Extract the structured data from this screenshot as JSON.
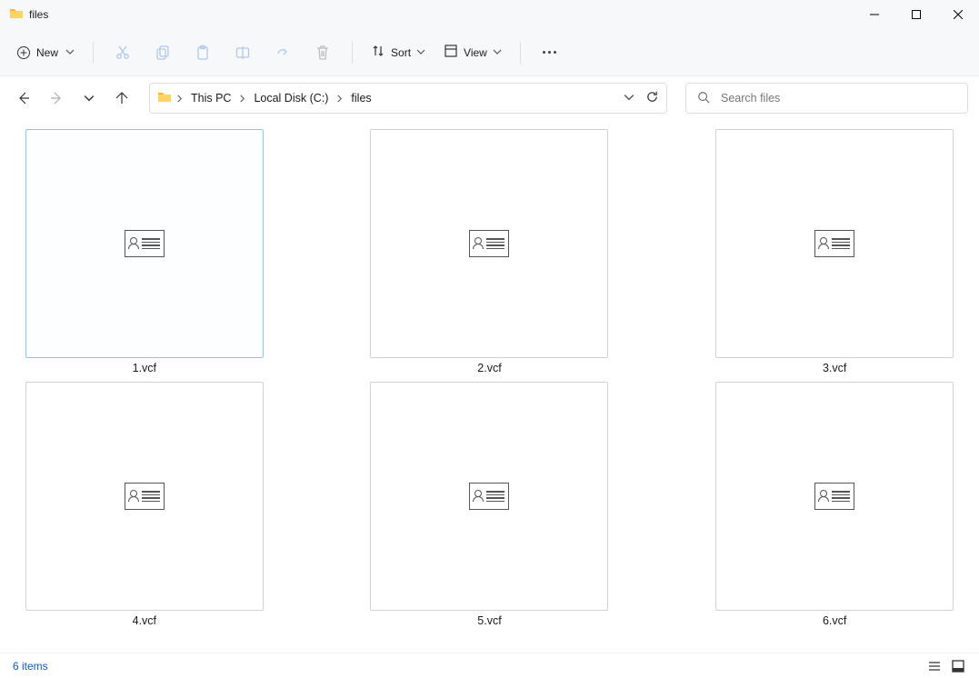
{
  "title": "files",
  "toolbar": {
    "new_label": "New",
    "sort_label": "Sort",
    "view_label": "View"
  },
  "breadcrumb": {
    "items": [
      "This PC",
      "Local Disk (C:)",
      "files"
    ]
  },
  "search": {
    "placeholder": "Search files"
  },
  "files": {
    "items": [
      {
        "name": "1.vcf",
        "selected": true
      },
      {
        "name": "2.vcf",
        "selected": false
      },
      {
        "name": "3.vcf",
        "selected": false
      },
      {
        "name": "4.vcf",
        "selected": false
      },
      {
        "name": "5.vcf",
        "selected": false
      },
      {
        "name": "6.vcf",
        "selected": false
      }
    ]
  },
  "status": {
    "text": "6 items"
  }
}
